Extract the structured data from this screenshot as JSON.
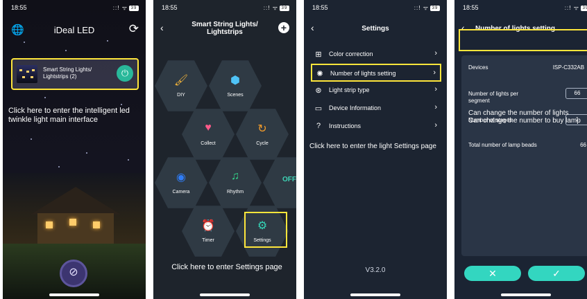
{
  "status": {
    "time": "18:55",
    "signal": "::! ᯤ",
    "battery": "39"
  },
  "screen1": {
    "title": "iDeal LED",
    "globe_icon": "🌐",
    "refresh_icon": "⟳",
    "device_name_line1": "Smart String Lights/",
    "device_name_line2": "Lightstrips (2)",
    "power_icon": "⏻",
    "caption": "Click here to enter the intelligent led twinkle light main interface",
    "fab_icon": "⊘"
  },
  "screen2": {
    "back": "‹",
    "title_line1": "Smart String Lights/",
    "title_line2": "Lightstrips",
    "add": "+",
    "tiles": [
      {
        "label": "DIY",
        "icon": "🖌",
        "color": "#f3b43a"
      },
      {
        "label": "Scenes",
        "icon": "⬢",
        "color": "#4fc3f7"
      },
      {
        "label": "Collect",
        "icon": "♥",
        "color": "#ff5a8a"
      },
      {
        "label": "Cycle",
        "icon": "↻",
        "color": "#f39c2b"
      },
      {
        "label": "Camera",
        "icon": "◉",
        "color": "#2f7cf6"
      },
      {
        "label": "Rhythm",
        "icon": "♫",
        "color": "#33d68a"
      },
      {
        "label": "",
        "icon": "OFF",
        "color": "#3ed3b5"
      },
      {
        "label": "Timer",
        "icon": "⏰",
        "color": "#ff6b6b"
      },
      {
        "label": "Settings",
        "icon": "⚙",
        "color": "#35d6b8"
      }
    ],
    "caption": "Click here to enter Settings page"
  },
  "screen3": {
    "back": "‹",
    "title": "Settings",
    "menu": [
      {
        "icon": "⊞",
        "label": "Color correction",
        "chevron": "›"
      },
      {
        "icon": "✺",
        "label": "Number of lights setting",
        "chevron": "›"
      },
      {
        "icon": "⊛",
        "label": "Light strip type",
        "chevron": "›"
      },
      {
        "icon": "▭",
        "label": "Device Information",
        "chevron": "›"
      },
      {
        "icon": "?",
        "label": "Instructions",
        "chevron": "›"
      }
    ],
    "caption": "Click here to enter the light Settings page",
    "version": "V3.2.0"
  },
  "screen4": {
    "back": "‹",
    "title": "Number of lights setting",
    "devices_label": "Devices",
    "devices_value": "ISP-C332AB",
    "devices_chevron": "⌄",
    "per_segment_label_line1": "Number of lights per",
    "per_segment_label_line2": "segment",
    "per_segment_value": "66",
    "stages_label": "Number of stages",
    "stages_value": "1",
    "total_label": "Total number of lamp beads",
    "total_value": "66",
    "note_line1": "Can change the number of lights",
    "note_line2": "Can change the number to buy lamp",
    "cancel_icon": "✕",
    "confirm_icon": "✓"
  }
}
